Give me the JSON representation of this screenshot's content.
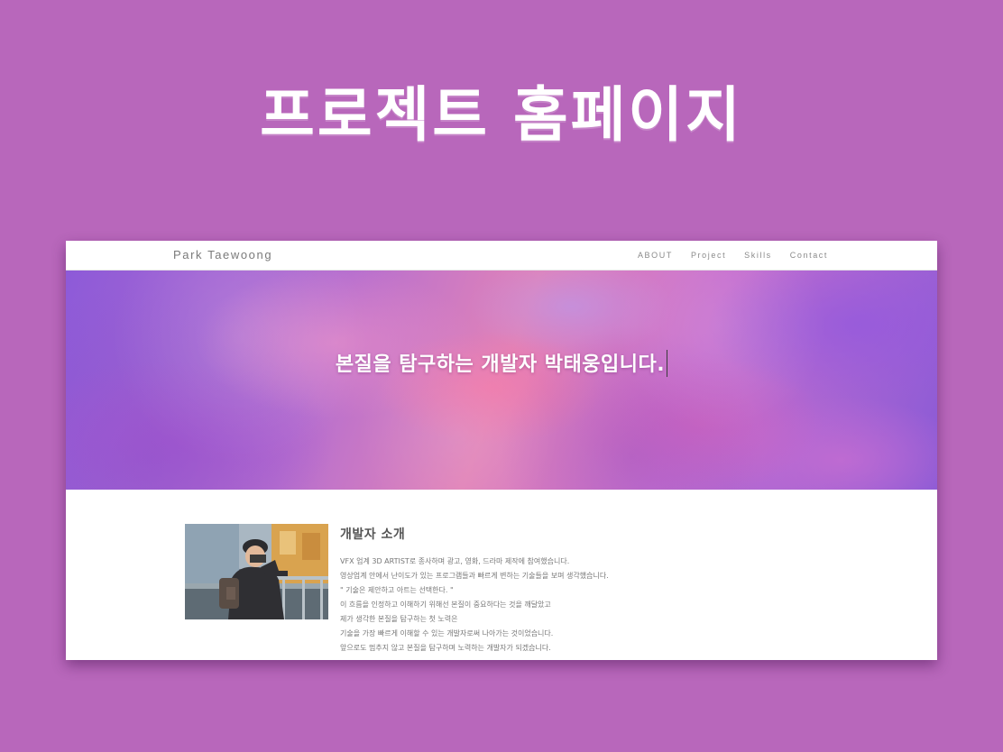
{
  "page": {
    "headline": "프로젝트 홈페이지",
    "background_color": "#b867bb"
  },
  "navbar": {
    "brand": "Park Taewoong",
    "links": [
      "ABOUT",
      "Project",
      "Skills",
      "Contact"
    ]
  },
  "hero": {
    "title": "본질을 탐구하는 개발자 박태웅입니다."
  },
  "about": {
    "title": "개발자 소개",
    "lines": [
      "VFX 업계 3D ARTIST로 종사하며 광고, 영화, 드라마 제작에 참여했습니다.",
      "영상업계 안에서 난이도가 있는 프로그램들과 빠르게 변하는 기술들을 보며 생각했습니다.",
      "\" 기술은 제안하고 아트는 선택한다. \"",
      "이 흐름을 인정하고 이해하기 위해선 본질이 중요하다는 것을 깨달았고",
      "제가 생각한 본질을 탐구하는 첫 노력은",
      "기술을 가장 빠르게 이해할 수 있는 개발자로써 나아가는 것이었습니다.",
      "앞으로도 멈추지 않고 본질을 탐구하며 노력하는 개발자가 되겠습니다."
    ]
  }
}
